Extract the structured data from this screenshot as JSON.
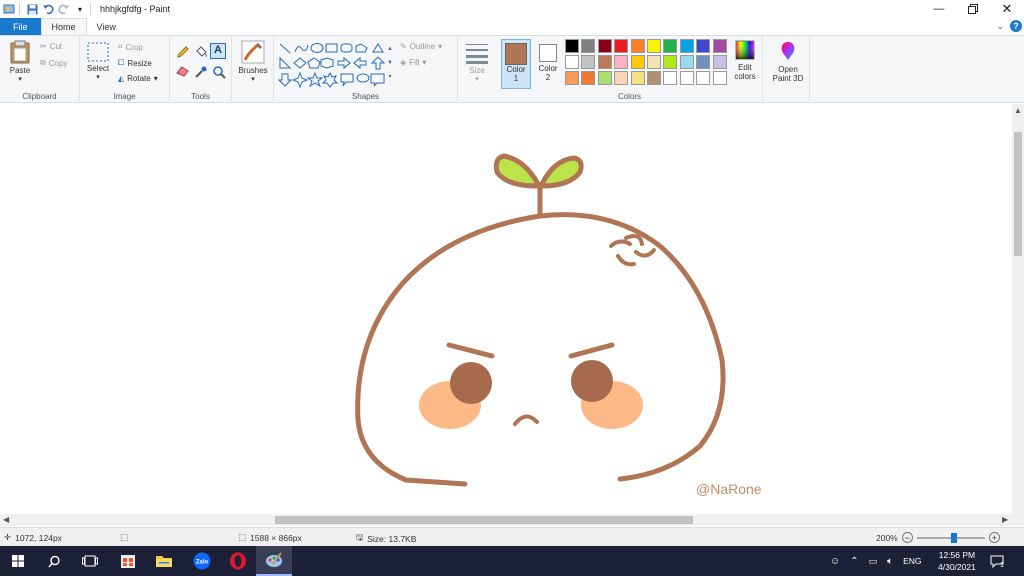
{
  "window": {
    "title": "hhhjkgfdfg - Paint"
  },
  "tabs": [
    {
      "label": "File"
    },
    {
      "label": "Home"
    },
    {
      "label": "View"
    }
  ],
  "ribbon": {
    "clipboard": {
      "paste": "Paste",
      "cut": "Cut",
      "copy": "Copy",
      "label": "Clipboard"
    },
    "image": {
      "select": "Select",
      "crop": "Crop",
      "resize": "Resize",
      "rotate": "Rotate",
      "label": "Image"
    },
    "tools": {
      "label": "Tools"
    },
    "brushes": {
      "label": "Brushes"
    },
    "shapes": {
      "outline": "Outline",
      "fill": "Fill",
      "label": "Shapes"
    },
    "size": {
      "label": "Size"
    },
    "colors": {
      "color1_label": "Color",
      "color1_num": "1",
      "color2_label": "Color",
      "color2_num": "2",
      "edit": "Edit colors",
      "label": "Colors",
      "color1": "#b07555",
      "color2": "#ffffff",
      "palette_row1": [
        "#000000",
        "#7f7f7f",
        "#880015",
        "#ed1c24",
        "#ff7f27",
        "#fff200",
        "#22b14c",
        "#00a2e8",
        "#3f48cc",
        "#a349a4"
      ],
      "palette_row2": [
        "#ffffff",
        "#c3c3c3",
        "#b97a57",
        "#ffaec9",
        "#ffc90e",
        "#efe4b0",
        "#b5e61d",
        "#99d9ea",
        "#7092be",
        "#c8bfe7"
      ],
      "palette_row3": [
        "#f79a5a",
        "#f07832",
        "#a8e070",
        "#fbd5b5",
        "#f6e080",
        "#b08f76",
        "#ffffff",
        "#ffffff",
        "#ffffff",
        "#ffffff"
      ]
    },
    "paint3d": {
      "label": "Open Paint 3D"
    }
  },
  "drawing": {
    "signature": "@NaRone"
  },
  "status": {
    "cursor": "1072, 124px",
    "dimensions": "1588 × 866px",
    "size": "Size: 13.7KB",
    "zoom": "200%"
  },
  "taskbar": {
    "lang": "ENG",
    "time": "12:56 PM",
    "date": "4/30/2021"
  }
}
